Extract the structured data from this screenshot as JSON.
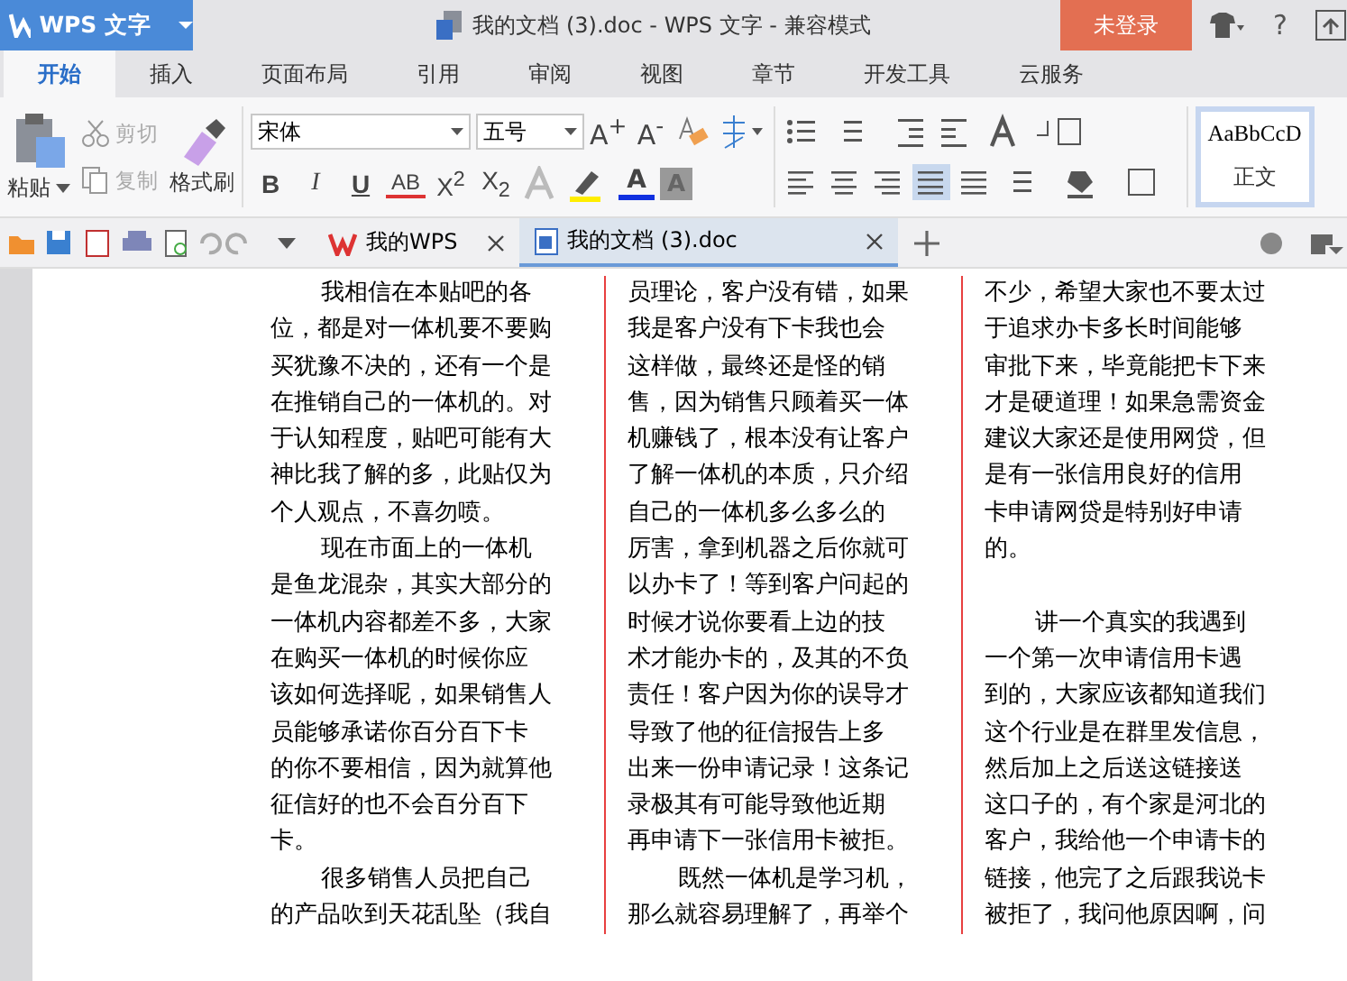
{
  "app_menu": {
    "label": "WPS 文字"
  },
  "title": "我的文档 (3).doc - WPS 文字 - 兼容模式",
  "login_button": "未登录",
  "help_label": "?",
  "ribbon_tabs": [
    {
      "label": "开始",
      "selected": true
    },
    {
      "label": "插入",
      "selected": false
    },
    {
      "label": "页面布局",
      "selected": false
    },
    {
      "label": "引用",
      "selected": false
    },
    {
      "label": "审阅",
      "selected": false
    },
    {
      "label": "视图",
      "selected": false
    },
    {
      "label": "章节",
      "selected": false
    },
    {
      "label": "开发工具",
      "selected": false
    },
    {
      "label": "云服务",
      "selected": false
    }
  ],
  "paste_label": "粘贴",
  "clipboard_items": [
    {
      "kind": "cut",
      "label": "剪切",
      "disabled": true
    },
    {
      "kind": "copy",
      "label": "复制",
      "disabled": true
    }
  ],
  "format_painter": "格式刷",
  "font": {
    "family": "宋体",
    "size": "五号"
  },
  "size_buttons": [
    "A$^{+}$",
    "A$^{-}$"
  ],
  "format_buttons": [
    {
      "kind": "bold",
      "label": "B"
    },
    {
      "kind": "italic",
      "label": "I"
    },
    {
      "kind": "underline",
      "label": "U"
    },
    {
      "kind": "strike",
      "label": "AB"
    },
    {
      "kind": "plain",
      "label": "X$^{2}$"
    },
    {
      "kind": "plain",
      "label": "X$_{2}$"
    }
  ],
  "font_color_label": "A",
  "shading_label": "A",
  "alignment": [
    {
      "kind": "left",
      "selected": false
    },
    {
      "kind": "center",
      "selected": false
    },
    {
      "kind": "right",
      "selected": false
    },
    {
      "kind": "justify",
      "selected": true
    },
    {
      "kind": "distributed",
      "selected": false
    }
  ],
  "style_gallery": [
    {
      "preview": "AaBbCcD",
      "label": "正文",
      "selected": true
    }
  ],
  "doc_tabs": [
    {
      "kind": "home",
      "label": "我的WPS",
      "selected": false
    },
    {
      "kind": "doc",
      "label": "我的文档 (3).doc",
      "selected": true
    }
  ],
  "columns": [
    {
      "paragraphs": [
        {
          "indent": true,
          "blank_before": false,
          "lines": [
            "我相信在本贴吧的各",
            "位，都是对一体机要不要购",
            "买犹豫不决的，还有一个是",
            "在推销自己的一体机的。对",
            "于认知程度，贴吧可能有大",
            "神比我了解的多，此贴仅为",
            "个人观点，不喜勿喷。"
          ]
        },
        {
          "indent": true,
          "blank_before": false,
          "lines": [
            "现在市面上的一体机",
            "是鱼龙混杂，其实大部分的",
            "一体机内容都差不多，大家",
            "在购买一体机的时候你应",
            "该如何选择呢，如果销售人",
            "员能够承诺你百分百下卡",
            "的你不要相信，因为就算他",
            "征信好的也不会百分百下",
            "卡。"
          ]
        },
        {
          "indent": true,
          "blank_before": false,
          "lines": [
            "很多销售人员把自己",
            "的产品吹到天花乱坠（我自"
          ]
        }
      ]
    },
    {
      "paragraphs": [
        {
          "indent": false,
          "blank_before": false,
          "lines": [
            "员理论，客户没有错，如果",
            "我是客户没有下卡我也会",
            "这样做，最终还是怪的销",
            "售，因为销售只顾着买一体",
            "机赚钱了，根本没有让客户",
            "了解一体机的本质，只介绍",
            "自己的一体机多么多么的",
            "厉害，拿到机器之后你就可",
            "以办卡了！等到客户问起的",
            "时候才说你要看上边的技",
            "术才能办卡的，及其的不负",
            "责任！客户因为你的误导才",
            "导致了他的征信报告上多",
            "出来一份申请记录！这条记",
            "录极其有可能导致他近期",
            "再申请下一张信用卡被拒。"
          ]
        },
        {
          "indent": true,
          "blank_before": false,
          "lines": [
            "既然一体机是学习机，",
            "那么就容易理解了，再举个"
          ]
        }
      ]
    },
    {
      "paragraphs": [
        {
          "indent": false,
          "blank_before": false,
          "lines": [
            "不少，希望大家也不要太过",
            "于追求办卡多长时间能够",
            "审批下来，毕竟能把卡下来",
            "才是硬道理！如果急需资金",
            "建议大家还是使用网贷，但",
            "是有一张信用良好的信用",
            "卡申请网贷是特别好申请",
            "的。"
          ]
        },
        {
          "indent": true,
          "blank_before": true,
          "lines": [
            "讲一个真实的我遇到",
            "一个第一次申请信用卡遇",
            "到的，大家应该都知道我们",
            "这个行业是在群里发信息，",
            "然后加上之后送这链接送",
            "这口子的，有个家是河北的",
            "客户，我给他一个申请卡的",
            "链接，他完了之后跟我说卡",
            "被拒了，我问他原因啊，问"
          ]
        }
      ]
    }
  ]
}
